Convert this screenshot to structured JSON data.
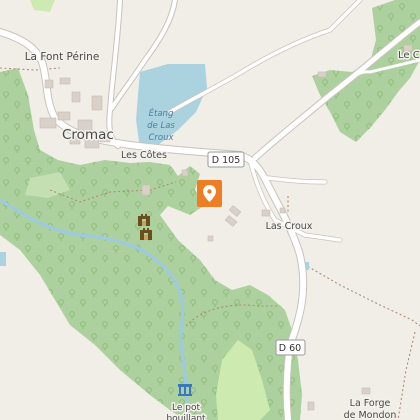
{
  "map": {
    "places": {
      "la_font_perine": "La Font Périne",
      "cromac": "Cromac",
      "les_cotes": "Les Côtes",
      "las_croux": "Las Croux",
      "la_forge_line1": "La Forge",
      "la_forge_line2": "de Mondon",
      "le_c_partial": "Le C",
      "le_pot_line1": "Le pot",
      "le_pot_line2": "bouillant"
    },
    "water": {
      "etang_line1": "Étang",
      "etang_line2": "de Las",
      "etang_line3": "Croux"
    },
    "roads": {
      "d105": "D 105",
      "d60": "D 60"
    },
    "icons": {
      "pin": "map-pin-icon",
      "castle": "castle-ruin-icon",
      "monument": "monument-icon"
    },
    "colors": {
      "background": "#f1eee8",
      "forest": "#add19e",
      "forest_dark": "#9fc98e",
      "meadow": "#cdebb0",
      "water": "#aad3df",
      "river": "#9ecae1",
      "road": "#ffffff",
      "road_casing": "#c8c3bb",
      "building": "#d9d0c9",
      "pin": "#ef7d22",
      "track": "#b08a74"
    }
  }
}
